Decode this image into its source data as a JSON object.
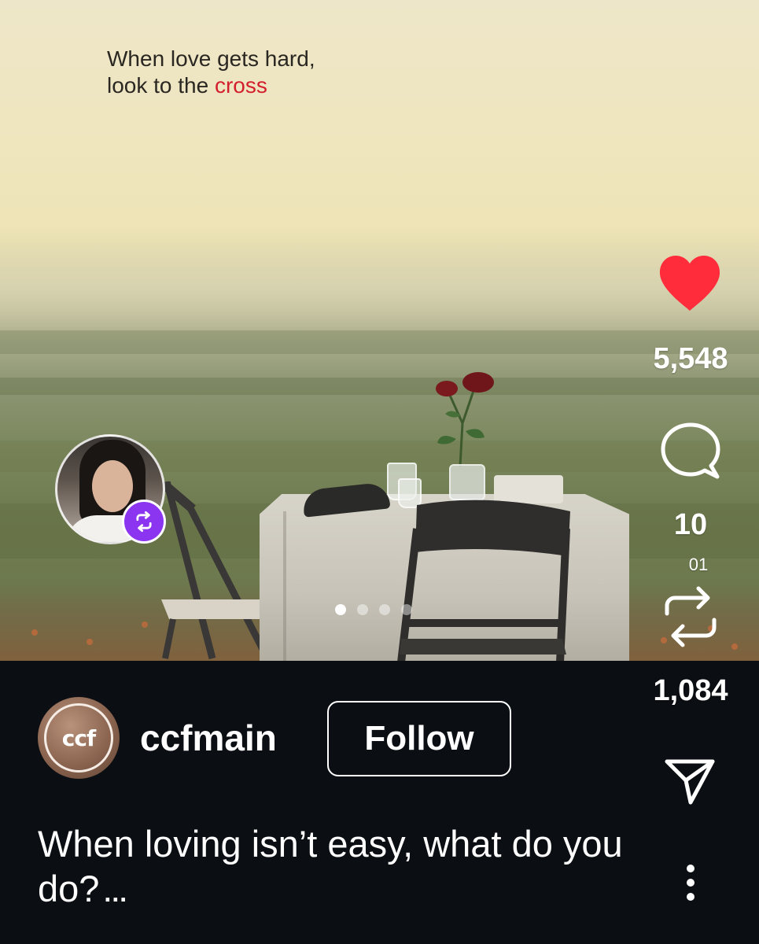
{
  "post": {
    "quote_line1": "When love gets hard,",
    "quote_line2_prefix": "look to the ",
    "quote_line2_highlight": "cross",
    "slide_count": 4,
    "active_slide": 1
  },
  "actions": {
    "likes": "5,548",
    "comments": "10",
    "repost_label": "01",
    "reposts": "1,084",
    "like_icon": "heart-filled-icon",
    "comment_icon": "speech-bubble-icon",
    "repost_icon": "repost-arrows-icon",
    "share_icon": "paper-plane-icon",
    "more_icon": "vertical-ellipsis-icon"
  },
  "account": {
    "username": "ccfmain",
    "logo_text": "ccf",
    "follow_label": "Follow"
  },
  "caption": {
    "text": "When loving isn’t easy, what do you do?",
    "more_indicator": "..."
  },
  "colors": {
    "like_red": "#ff2d3b",
    "repost_badge": "#8b35f0",
    "highlight_red": "#d31f2d",
    "background": "#0b0e12"
  }
}
